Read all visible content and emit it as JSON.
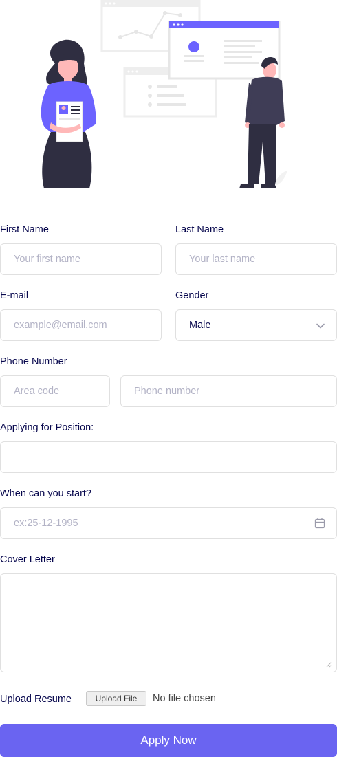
{
  "form": {
    "first_name": {
      "label": "First Name",
      "placeholder": "Your first name"
    },
    "last_name": {
      "label": "Last Name",
      "placeholder": "Your last name"
    },
    "email": {
      "label": "E-mail",
      "placeholder": "example@email.com"
    },
    "gender": {
      "label": "Gender",
      "selected": "Male"
    },
    "phone": {
      "label": "Phone Number",
      "area_placeholder": "Area code",
      "number_placeholder": "Phone number"
    },
    "position": {
      "label": "Applying for Position:"
    },
    "start_date": {
      "label": "When can you start?",
      "placeholder": "ex:25-12-1995"
    },
    "cover_letter": {
      "label": "Cover Letter"
    },
    "resume": {
      "label": "Upload Resume",
      "button": "Upload File",
      "status": "No file chosen"
    },
    "submit_label": "Apply Now"
  },
  "colors": {
    "accent": "#6a64f1",
    "text": "#07074d",
    "border": "#e0e0e0",
    "placeholder": "#b3b3c6"
  },
  "icons": {
    "gender_select": "chevron-down-icon",
    "start_date": "calendar-icon",
    "hero": "recruitment-illustration"
  }
}
